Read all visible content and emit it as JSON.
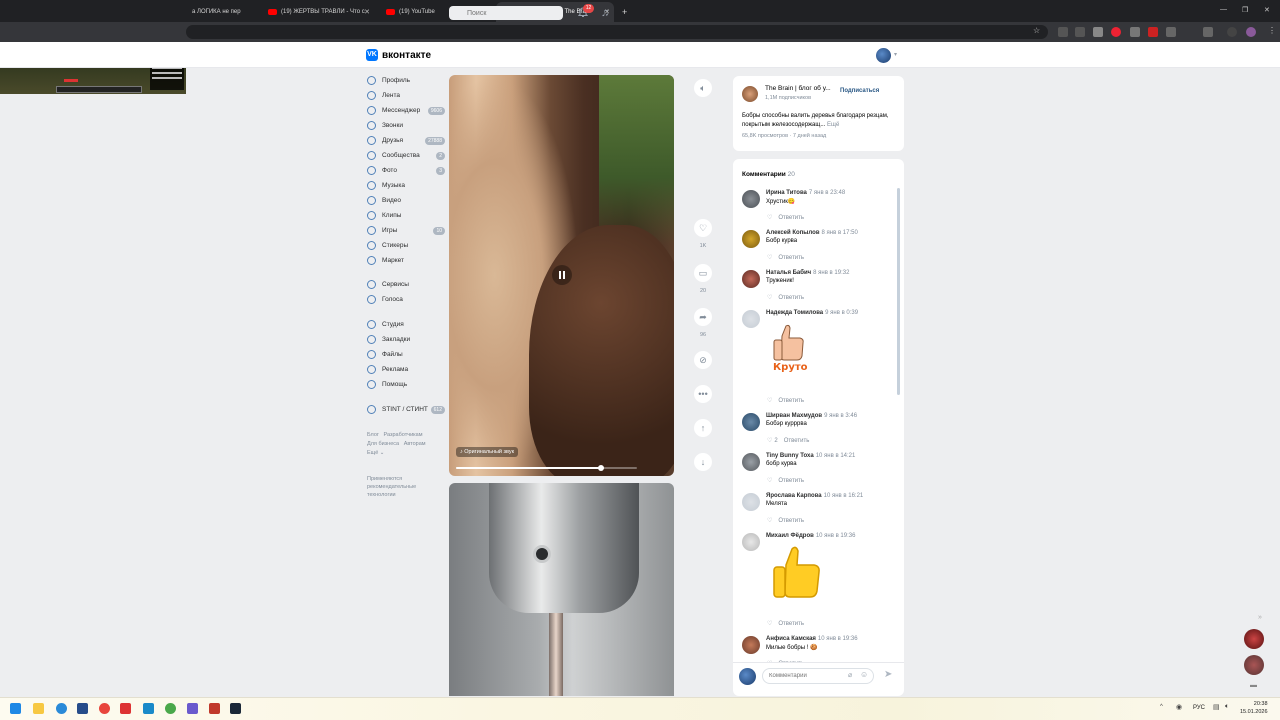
{
  "browser": {
    "tabs": [
      {
        "title": "а ЛОГИКА не пер",
        "icon": "youtube-icon"
      },
      {
        "title": "(19) ЖЕРТВЫ ТРАВЛИ - Что с",
        "icon": "youtube-icon"
      },
      {
        "title": "(19) YouTube",
        "icon": "youtube-icon"
      },
      {
        "title": "Клип сообщества The Brain",
        "icon": "vk-icon",
        "active": true
      }
    ],
    "new_tab": "+"
  },
  "header": {
    "logo_text": "вконтакте",
    "search_placeholder": "Поиск",
    "notifications_count": "12"
  },
  "sidebar": {
    "items": [
      {
        "label": "Профиль",
        "count": ""
      },
      {
        "label": "Лента",
        "count": ""
      },
      {
        "label": "Мессенджер",
        "count": "9606"
      },
      {
        "label": "Звонки",
        "count": ""
      },
      {
        "label": "Друзья",
        "count": "27888"
      },
      {
        "label": "Сообщества",
        "count": "2"
      },
      {
        "label": "Фото",
        "count": "3"
      },
      {
        "label": "Музыка",
        "count": ""
      },
      {
        "label": "Видео",
        "count": ""
      },
      {
        "label": "Клипы",
        "count": ""
      },
      {
        "label": "Игры",
        "count": "10"
      },
      {
        "label": "Стикеры",
        "count": ""
      },
      {
        "label": "Маркет",
        "count": ""
      },
      {
        "label": "Сервисы",
        "count": ""
      },
      {
        "label": "Голоса",
        "count": ""
      },
      {
        "label": "Студия",
        "count": ""
      },
      {
        "label": "Закладки",
        "count": ""
      },
      {
        "label": "Файлы",
        "count": ""
      },
      {
        "label": "Реклама",
        "count": ""
      },
      {
        "label": "Помощь",
        "count": ""
      },
      {
        "label": "STINT / СТИНТ",
        "count": "612"
      }
    ],
    "footer_links": [
      "Блог",
      "Разработчикам",
      "Для бизнеса",
      "Авторам",
      "Ещё"
    ],
    "recommend_note": "Применяются рекомендательные технологии"
  },
  "player": {
    "audio_label": "♪ Оригинальный звук",
    "progress": 0.8,
    "likes": "1K",
    "comments": "20",
    "shares": "96"
  },
  "info": {
    "channel_name": "The Brain | блог об у...",
    "subscribers": "1,1М подписчиков",
    "subscribe_label": "Подписаться",
    "description": "Бобры способны валить деревья благодаря резцам, покрытым железосодержащ...",
    "more_label": "Ещё",
    "views": "65,8K просмотров · 7 дней назад"
  },
  "comments": {
    "title": "Комментарии",
    "count": "20",
    "reply_label": "Ответить",
    "items": [
      {
        "name": "Ирина Титова",
        "date": "7 янв в 23:48",
        "text": "Хрустик😋",
        "likes": ""
      },
      {
        "name": "Алексей Копылов",
        "date": "8 янв в 17:50",
        "text": "Бобр курва",
        "likes": ""
      },
      {
        "name": "Наталья Бабич",
        "date": "8 янв в 19:32",
        "text": "Труженик!",
        "likes": ""
      },
      {
        "name": "Надежда Томилова",
        "date": "9 янв в 0:39",
        "text": "",
        "sticker_text": "Круто",
        "likes": ""
      },
      {
        "name": "Ширван Махмудов",
        "date": "9 янв в 3:46",
        "text": "Бобэр курррва",
        "likes": "2"
      },
      {
        "name": "Tiny Bunny Тоха",
        "date": "10 янв в 14:21",
        "text": "бобр курва",
        "likes": ""
      },
      {
        "name": "Ярослава Карпова",
        "date": "10 янв в 16:21",
        "text": "Мелята",
        "likes": ""
      },
      {
        "name": "Михаил Фёдров",
        "date": "10 янв в 19:36",
        "text": "",
        "likes": ""
      },
      {
        "name": "Анфиса Камская",
        "date": "10 янв в 19:36",
        "text": "Милые бобры ! 🍪",
        "likes": ""
      }
    ],
    "input_placeholder": "Комментарий"
  },
  "taskbar": {
    "lang": "РУС",
    "time": "20:38",
    "date": "15.01.2026"
  },
  "colors": {
    "vk_blue": "#0077ff",
    "link": "#2a5885",
    "badge_red": "#e64646",
    "bg": "#edeef0"
  }
}
